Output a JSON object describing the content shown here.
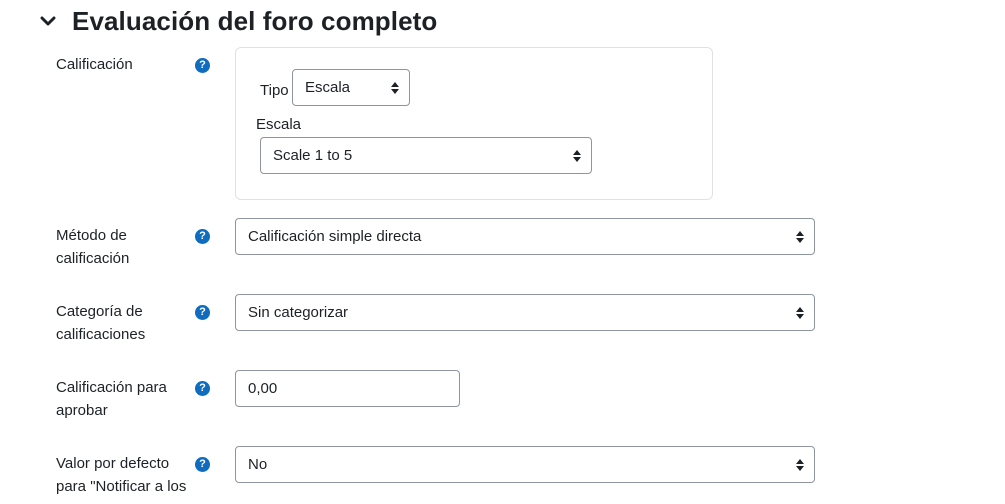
{
  "section": {
    "title": "Evaluación del foro completo"
  },
  "grade": {
    "label": "Calificación",
    "type_label": "Tipo",
    "type_value": "Escala",
    "scale_label": "Escala",
    "scale_value": "Scale 1 to 5"
  },
  "grading_method": {
    "label_line1": "Método de",
    "label_line2": "calificación",
    "value": "Calificación simple directa"
  },
  "grade_category": {
    "label_line1": "Categoría de",
    "label_line2": "calificaciones",
    "value": "Sin categorizar"
  },
  "grade_to_pass": {
    "label_line1": "Calificación para",
    "label_line2": "aprobar",
    "value": "0,00"
  },
  "notify_default": {
    "label_line1": "Valor por defecto",
    "label_line2": "para \"Notificar a los",
    "value": "No"
  },
  "icons": {
    "collapse": "chevron-down-icon",
    "help": "question-circle-icon",
    "select_arrows": "sort-arrows-icon"
  },
  "colors": {
    "help_icon": "#0f6cbf",
    "text": "#1d2125",
    "border": "#8f959e"
  }
}
